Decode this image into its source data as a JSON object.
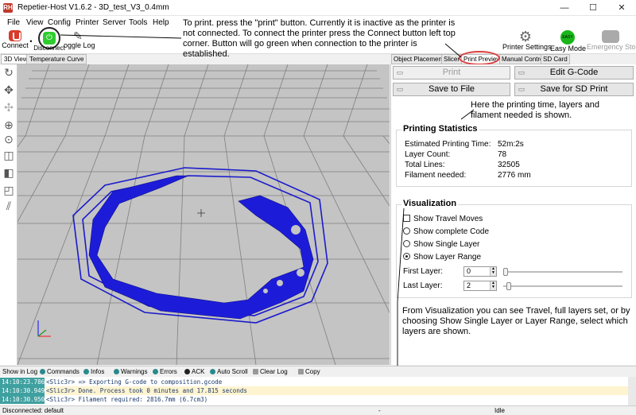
{
  "window": {
    "title": "Repetier-Host V1.6.2 - 3D_test_V3_0.4mm",
    "app_icon": "RH",
    "minimize": "—",
    "maximize": "☐",
    "close": "✕"
  },
  "menu": [
    "File",
    "View",
    "Config",
    "Printer",
    "Server",
    "Tools",
    "Help"
  ],
  "toolbar": {
    "connect_label": "Connect",
    "disconnect_label": "Disconnect",
    "toggle_log_label": "oggle Log",
    "printer_settings_label": "Printer Settings",
    "easy_mode_label": "Easy Mode",
    "easy_icon_text": "EASY",
    "emergency_stop_label": "Emergency Stop",
    "dot": "•"
  },
  "left_tabs": [
    "3D View",
    "Temperature Curve"
  ],
  "right_tabs": [
    "Object Placement",
    "Slicer",
    "Print Preview",
    "Manual Control",
    "SD Card"
  ],
  "preview": {
    "print_label": "Print",
    "edit_gcode_label": "Edit G-Code",
    "save_file_label": "Save to File",
    "save_sd_label": "Save for SD Print"
  },
  "stats": {
    "title": "Printing Statistics",
    "rows": [
      {
        "label": "Estimated Printing Time:",
        "value": "52m:2s"
      },
      {
        "label": "Layer Count:",
        "value": "78"
      },
      {
        "label": "Total Lines:",
        "value": "32505"
      },
      {
        "label": "Filament needed:",
        "value": "2776 mm"
      }
    ]
  },
  "visualization": {
    "title": "Visualization",
    "show_travel": "Show Travel Moves",
    "show_complete": "Show complete Code",
    "show_single": "Show Single Layer",
    "show_range": "Show Layer Range",
    "first_layer_label": "First Layer:",
    "first_layer_value": "0",
    "last_layer_label": "Last Layer:",
    "last_layer_value": "2",
    "selected": "Show Layer Range",
    "first_slider": 0.0,
    "last_slider": 0.03
  },
  "annotations": {
    "top": "To print. press the \"print\" button. Currently it is inactive as the printer is not connected. To connect the printer press the Connect button left top corner. Button will go green when connection to the printer is established.",
    "stats": "Here the printing time, layers and filament needed is shown.",
    "viz": "From Visualization you can see Travel, full layers set, or by choosing Show Single Layer or Layer Range, select which layers are shown."
  },
  "log_toolbar": {
    "show_in_log": "Show in Log",
    "items": [
      "Commands",
      "Infos",
      "Warnings",
      "Errors",
      "ACK",
      "Auto Scroll",
      "Clear Log",
      "Copy"
    ]
  },
  "log": [
    {
      "time": "14:10:23.786",
      "msg": "<Slic3r> => Exporting G-code to composition.gcode"
    },
    {
      "time": "14:10:30.949",
      "msg": "<Slic3r> Done. Process took 0 minutes and 17.815 seconds"
    },
    {
      "time": "14:10:30.950",
      "msg": "<Slic3r> Filament required: 2816.7mm (6.7cm3)"
    }
  ],
  "status": {
    "connection": "Disconnected: default",
    "state": "Idle",
    "separator": "-"
  },
  "icons": {
    "rotate": "↻",
    "move": "✥",
    "move2": "✣",
    "zoom_in": "⊕",
    "zoom_fit": "⊙",
    "cube1": "◫",
    "cube2": "◧",
    "cube3": "◰",
    "slash": "⫽",
    "gear": "⚙",
    "pencil": "✎",
    "power": "⏻",
    "file": "▭",
    "up": "▲",
    "down": "▼"
  },
  "colors": {
    "accent_red": "#e03c3c",
    "path_blue": "#1a1acc",
    "connect_green": "#2ecc2e"
  }
}
